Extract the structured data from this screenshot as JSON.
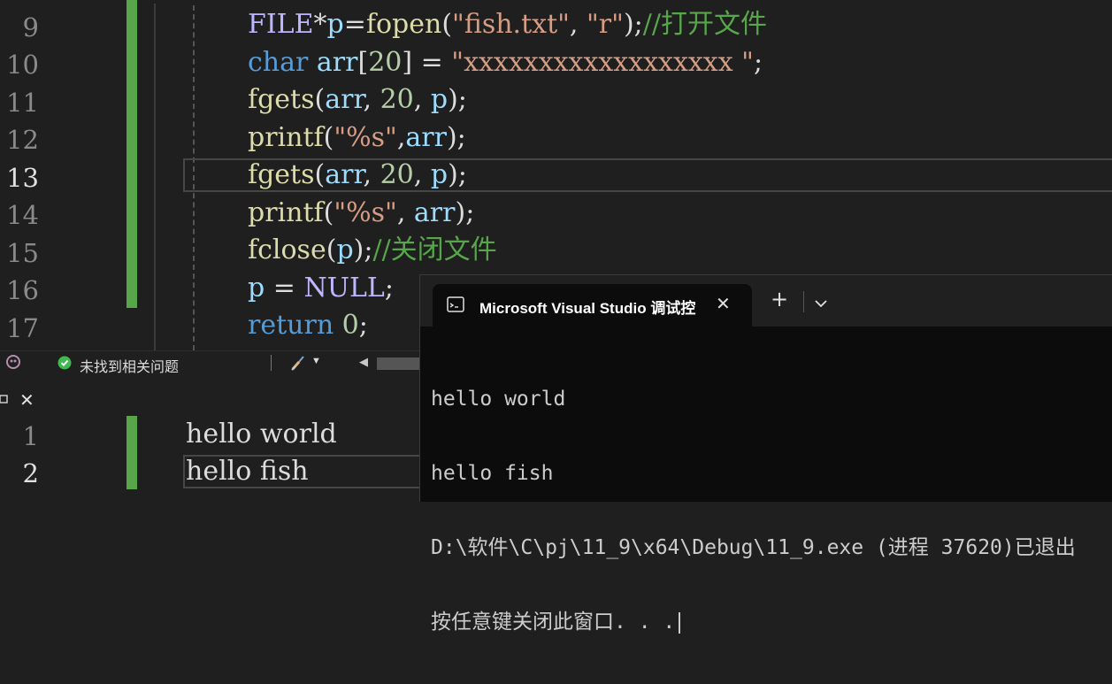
{
  "editor": {
    "line_numbers": [
      "9",
      "10",
      "11",
      "12",
      "13",
      "14",
      "15",
      "16",
      "17"
    ],
    "active_line": "13",
    "lines": [
      [
        {
          "t": "FILE",
          "c": "mac"
        },
        {
          "t": "*",
          "c": "plain"
        },
        {
          "t": "p",
          "c": "var"
        },
        {
          "t": "=",
          "c": "plain"
        },
        {
          "t": "fopen",
          "c": "fn"
        },
        {
          "t": "(",
          "c": "plain"
        },
        {
          "t": "\"fish.txt\"",
          "c": "str"
        },
        {
          "t": ", ",
          "c": "plain"
        },
        {
          "t": "\"r\"",
          "c": "str"
        },
        {
          "t": ");",
          "c": "plain"
        },
        {
          "t": "//打开文件",
          "c": "cm"
        }
      ],
      [
        {
          "t": "char ",
          "c": "kw"
        },
        {
          "t": "arr",
          "c": "var"
        },
        {
          "t": "[",
          "c": "plain"
        },
        {
          "t": "20",
          "c": "num"
        },
        {
          "t": "] = ",
          "c": "plain"
        },
        {
          "t": "\"xxxxxxxxxxxxxxxxxx \"",
          "c": "str"
        },
        {
          "t": ";",
          "c": "plain"
        }
      ],
      [
        {
          "t": "fgets",
          "c": "fn"
        },
        {
          "t": "(",
          "c": "plain"
        },
        {
          "t": "arr",
          "c": "var"
        },
        {
          "t": ", ",
          "c": "plain"
        },
        {
          "t": "20",
          "c": "num"
        },
        {
          "t": ", ",
          "c": "plain"
        },
        {
          "t": "p",
          "c": "var"
        },
        {
          "t": ");",
          "c": "plain"
        }
      ],
      [
        {
          "t": "printf",
          "c": "fn"
        },
        {
          "t": "(",
          "c": "plain"
        },
        {
          "t": "\"%s\"",
          "c": "str"
        },
        {
          "t": ",",
          "c": "plain"
        },
        {
          "t": "arr",
          "c": "var"
        },
        {
          "t": ");",
          "c": "plain"
        }
      ],
      [
        {
          "t": "fgets",
          "c": "fn"
        },
        {
          "t": "(",
          "c": "plain"
        },
        {
          "t": "arr",
          "c": "var"
        },
        {
          "t": ", ",
          "c": "plain"
        },
        {
          "t": "20",
          "c": "num"
        },
        {
          "t": ", ",
          "c": "plain"
        },
        {
          "t": "p",
          "c": "var"
        },
        {
          "t": ");",
          "c": "plain"
        }
      ],
      [
        {
          "t": "printf",
          "c": "fn"
        },
        {
          "t": "(",
          "c": "plain"
        },
        {
          "t": "\"%s\"",
          "c": "str"
        },
        {
          "t": ", ",
          "c": "plain"
        },
        {
          "t": "arr",
          "c": "var"
        },
        {
          "t": ");",
          "c": "plain"
        }
      ],
      [
        {
          "t": "fclose",
          "c": "fn"
        },
        {
          "t": "(",
          "c": "plain"
        },
        {
          "t": "p",
          "c": "var"
        },
        {
          "t": ");",
          "c": "plain"
        },
        {
          "t": "//关闭文件",
          "c": "cm"
        }
      ],
      [
        {
          "t": "p",
          "c": "var"
        },
        {
          "t": " = ",
          "c": "plain"
        },
        {
          "t": "NULL",
          "c": "mac"
        },
        {
          "t": ";",
          "c": "plain"
        }
      ],
      [
        {
          "t": "return ",
          "c": "kw"
        },
        {
          "t": "0",
          "c": "num"
        },
        {
          "t": ";",
          "c": "plain"
        }
      ]
    ]
  },
  "status": {
    "issues_text": "未找到相关问题",
    "issues_icon": "check-circle-icon",
    "brush_icon": "cleanup-brush-icon"
  },
  "output_panel": {
    "tab_close": "✕",
    "line_numbers": [
      "1",
      "2"
    ],
    "lines": [
      "hello world",
      "hello fish"
    ]
  },
  "terminal": {
    "tab_title": "Microsoft Visual Studio 调试控",
    "close_label": "✕",
    "new_tab_label": "+",
    "dropdown_label": "⌄",
    "lines": [
      "hello world",
      "hello fish",
      "D:\\软件\\C\\pj\\11_9\\x64\\Debug\\11_9.exe (进程 37620)已退出",
      "按任意键关闭此窗口. . ."
    ]
  },
  "colors": {
    "editor_bg": "#1f1f1f",
    "terminal_bg": "#0c0c0c",
    "change_marker": "#57a64a",
    "keyword": "#569cd6",
    "function": "#dcdcaa",
    "variable": "#9cdcfe",
    "string": "#d69d85",
    "comment": "#57a64a"
  }
}
